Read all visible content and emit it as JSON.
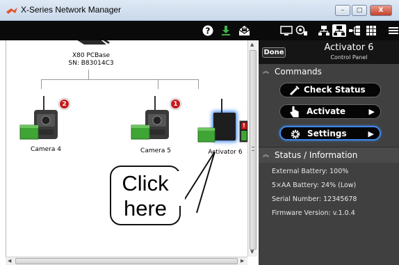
{
  "window": {
    "title": "X-Series Network Manager",
    "min_label": "–",
    "max_label": "□",
    "close_label": "X"
  },
  "toolbar": {
    "icons": [
      "help-icon",
      "download-icon",
      "mail-icon",
      "monitor-icon",
      "camera-film-icon",
      "network-icon",
      "network-selected-icon",
      "tree-icon",
      "grid-icon",
      "menu-icon"
    ]
  },
  "network": {
    "base": {
      "name": "X80 PCBase",
      "serial": "SN: B83014C3"
    },
    "devices": [
      {
        "label": "Camera 4",
        "badge": "2"
      },
      {
        "label": "Camera 5",
        "badge": "1"
      },
      {
        "label": "Activator 6",
        "badge": "!"
      }
    ]
  },
  "callout": {
    "line1": "Click",
    "line2": "here"
  },
  "panel": {
    "done": "Done",
    "title": "Activator 6",
    "subtitle": "Control Panel",
    "commands_heading": "Commands",
    "commands": [
      {
        "label": "Check Status",
        "icon": "probe-icon"
      },
      {
        "label": "Activate",
        "icon": "hand-pointer-icon"
      },
      {
        "label": "Settings",
        "icon": "gear-icon"
      }
    ],
    "status_heading": "Status / Information",
    "info": [
      "External Battery:  100%",
      "5×AA Battery:  24%  (Low)",
      "Serial Number: 12345678",
      "Firmware Version: v.1.0.4"
    ]
  },
  "colors": {
    "panel_bg": "#404040",
    "toolbar_bg": "#0a0a0a",
    "highlight_blue": "#3e86e8",
    "badge_red": "#c8191c",
    "battery_green": "#3fa535"
  }
}
